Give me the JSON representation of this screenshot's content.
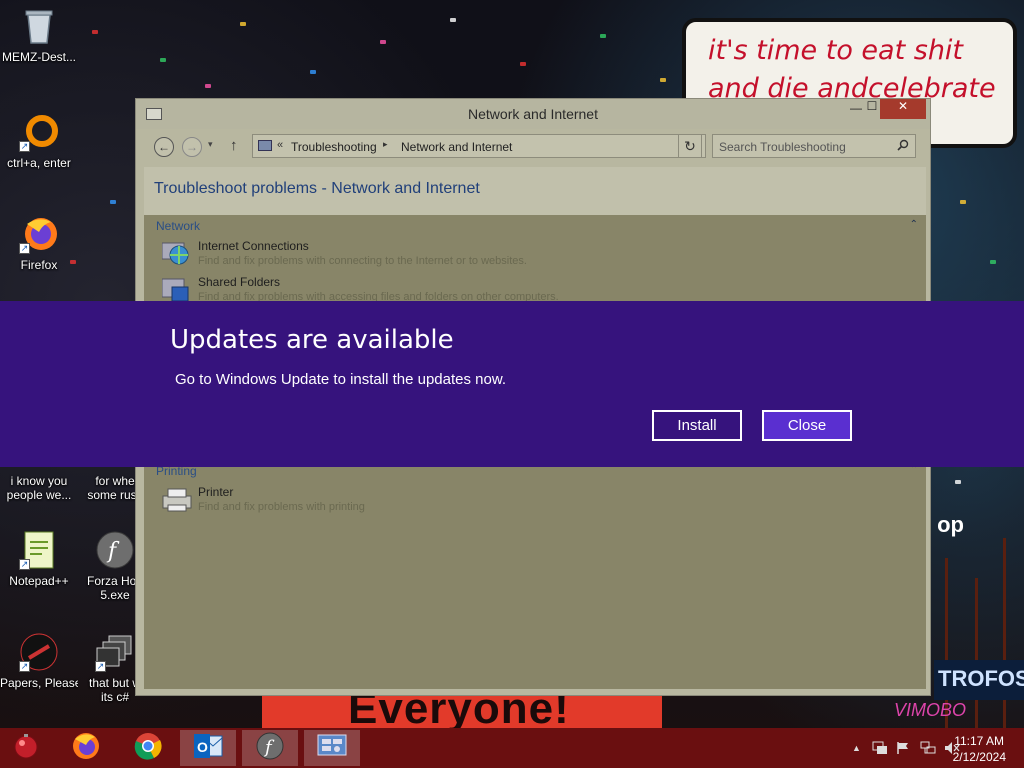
{
  "desktop": {
    "icons": [
      {
        "label": "MEMZ-Dest..."
      },
      {
        "label": "ctrl+a, enter"
      },
      {
        "label": "Firefox"
      },
      {
        "label": "i know you"
      },
      {
        "label": "people we..."
      },
      {
        "label": "for whe"
      },
      {
        "label": "some russ"
      },
      {
        "label": "Notepad++"
      },
      {
        "label": "Forza Hori"
      },
      {
        "label": "5.exe"
      },
      {
        "label": "Papers, Please"
      },
      {
        "label": "that but w"
      },
      {
        "label": "its c#"
      }
    ],
    "wallpaper_speech": "it's time to eat shit and die andcelebrate",
    "wallpaper_poster": "Everyone!",
    "wallpaper_sign": "TROFOS",
    "wallpaper_sign2": "VIMOBO",
    "wallpaper_op": "op"
  },
  "window": {
    "title": "Network and Internet",
    "nav": {
      "back": "←",
      "forward": "→",
      "up": "↑",
      "dropdown": "▾",
      "refresh": "↻"
    },
    "address": {
      "overflow": "«",
      "crumbs": [
        "Troubleshooting",
        "Network and Internet"
      ],
      "separator": "▸",
      "dropdown": "⌄"
    },
    "search": {
      "placeholder": "Search Troubleshooting"
    },
    "heading": "Troubleshoot problems - Network and Internet",
    "groups": [
      {
        "header": "Network",
        "chevron": "⌃",
        "items": [
          {
            "title": "Internet Connections",
            "desc": "Find and fix problems with connecting to the Internet or to websites.",
            "icon": "globe-network-icon"
          },
          {
            "title": "Shared Folders",
            "desc": "Find and fix problems with accessing files and folders on other computers.",
            "icon": "shared-folder-icon"
          }
        ]
      },
      {
        "header": "Printing",
        "chevron": "⌃",
        "items": [
          {
            "title": "Printer",
            "desc": "Find and fix problems with printing",
            "icon": "printer-icon"
          }
        ]
      }
    ],
    "controls": {
      "min": "—",
      "max": "☐",
      "close": "✕"
    }
  },
  "banner": {
    "title": "Updates are available",
    "message": "Go to Windows Update to install the updates now.",
    "install_label": "Install",
    "close_label": "Close",
    "color": "#36137d"
  },
  "taskbar": {
    "apps": [
      {
        "name": "start-ball-icon"
      },
      {
        "name": "firefox-icon"
      },
      {
        "name": "chrome-icon"
      },
      {
        "name": "outlook-icon"
      },
      {
        "name": "flash-icon"
      },
      {
        "name": "control-panel-icon"
      }
    ],
    "tray": {
      "chevron": "▲",
      "time": "11:17 AM",
      "date": "2/12/2024"
    },
    "color": "#6a0f10"
  }
}
